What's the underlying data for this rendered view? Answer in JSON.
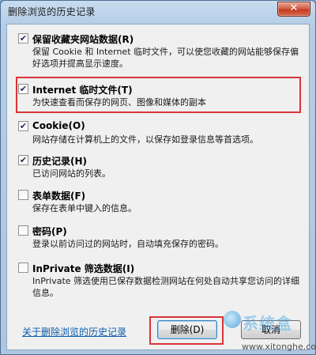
{
  "window": {
    "title": "删除浏览的历史记录",
    "close_glyph": "✕"
  },
  "options": [
    {
      "label": "保留收藏夹网站数据(R)",
      "checked": true,
      "desc": "保留 Cookie 和 Internet 临时文件，可以使您收藏的网站能够保存偏好选项并提高显示速度。"
    },
    {
      "label": "Internet 临时文件(T)",
      "checked": true,
      "desc": "为快速查看而保存的网页、图像和媒体的副本"
    },
    {
      "label": "Cookie(O)",
      "checked": true,
      "desc": "网站存储在计算机上的文件，以保存如登录信息等首选项。"
    },
    {
      "label": "历史记录(H)",
      "checked": true,
      "desc": "已访问网站的列表。"
    },
    {
      "label": "表单数据(F)",
      "checked": false,
      "desc": "保存在表单中键入的信息。"
    },
    {
      "label": "密码(P)",
      "checked": false,
      "desc": "登录以前访问过的网站时，自动填充保存的密码。"
    },
    {
      "label": "InPrivate 筛选数据(I)",
      "checked": false,
      "desc": "InPrivate 筛选使用已保存数据检测网站在何处自动共享您访问的详细信息。"
    }
  ],
  "footer": {
    "link": "关于删除浏览的历史记录",
    "delete_button": "删除(D)",
    "cancel_button": "取消"
  },
  "watermark": {
    "brand": "系统盒",
    "url": "www.xitonghe.com"
  },
  "icons": {
    "checkmark": "✔"
  }
}
